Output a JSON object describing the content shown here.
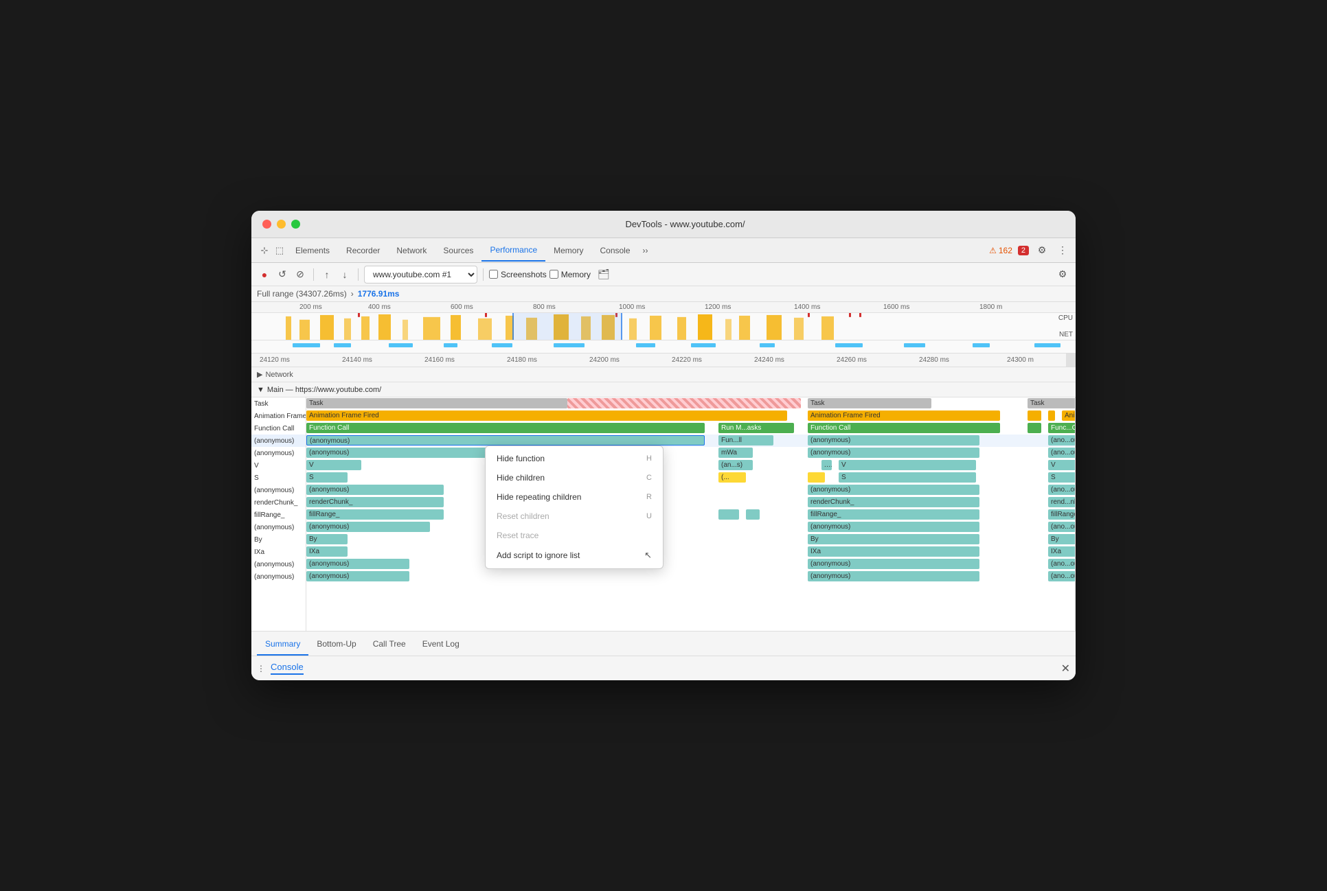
{
  "window": {
    "title": "DevTools - www.youtube.com/"
  },
  "tabs": [
    {
      "label": "Elements",
      "active": false
    },
    {
      "label": "Recorder",
      "active": false
    },
    {
      "label": "Network",
      "active": false
    },
    {
      "label": "Sources",
      "active": false
    },
    {
      "label": "Performance",
      "active": true
    },
    {
      "label": "Memory",
      "active": false
    },
    {
      "label": "Console",
      "active": false
    }
  ],
  "badges": {
    "warning": "162",
    "error": "2"
  },
  "toolbar": {
    "record_label": "●",
    "reload_label": "↺",
    "clear_label": "⊘",
    "upload_label": "↑",
    "download_label": "↓",
    "url_value": "www.youtube.com #1",
    "screenshots_label": "Screenshots",
    "memory_label": "Memory"
  },
  "range": {
    "full_label": "Full range (34307.26ms)",
    "selected_label": "1776.91ms"
  },
  "ruler": {
    "marks": [
      "24120 ms",
      "24140 ms",
      "24160 ms",
      "24180 ms",
      "24200 ms",
      "24220 ms",
      "24240 ms",
      "24260 ms",
      "24280 ms",
      "24300 m"
    ]
  },
  "overview": {
    "ms_marks": [
      "200 ms",
      "400 ms",
      "600 ms",
      "800 ms",
      "1000 ms",
      "1200 ms",
      "1400 ms",
      "1600 ms",
      "1800 m"
    ],
    "cpu_label": "CPU",
    "net_label": "NET"
  },
  "network_section": {
    "label": "Network",
    "collapsed": false
  },
  "main_thread": {
    "label": "Main — https://www.youtube.com/"
  },
  "flame_rows": [
    {
      "label": "Task",
      "type": "task"
    },
    {
      "label": "Animation Frame Fired",
      "type": "animation"
    },
    {
      "label": "Function Call",
      "type": "func"
    },
    {
      "label": "(anonymous)",
      "type": "anon"
    },
    {
      "label": "(anonymous)",
      "type": "anon"
    },
    {
      "label": "V",
      "type": "v"
    },
    {
      "label": "S",
      "type": "s"
    },
    {
      "label": "(anonymous)",
      "type": "anon"
    },
    {
      "label": "renderChunk_",
      "type": "anon"
    },
    {
      "label": "fillRange_",
      "type": "anon"
    },
    {
      "label": "(anonymous)",
      "type": "anon"
    },
    {
      "label": "By",
      "type": "anon"
    },
    {
      "label": "IXa",
      "type": "anon"
    },
    {
      "label": "(anonymous)",
      "type": "anon"
    },
    {
      "label": "(anonymous)",
      "type": "anon"
    }
  ],
  "context_menu": {
    "items": [
      {
        "label": "Hide function",
        "shortcut": "H",
        "disabled": false
      },
      {
        "label": "Hide children",
        "shortcut": "C",
        "disabled": false
      },
      {
        "label": "Hide repeating children",
        "shortcut": "R",
        "disabled": false
      },
      {
        "label": "Reset children",
        "shortcut": "U",
        "disabled": true
      },
      {
        "label": "Reset trace",
        "shortcut": "",
        "disabled": true
      },
      {
        "label": "Add script to ignore list",
        "shortcut": "",
        "disabled": false
      }
    ]
  },
  "bottom_tabs": [
    {
      "label": "Summary",
      "active": true
    },
    {
      "label": "Bottom-Up",
      "active": false
    },
    {
      "label": "Call Tree",
      "active": false
    },
    {
      "label": "Event Log",
      "active": false
    }
  ],
  "console_bar": {
    "dots": "⋮",
    "label": "Console",
    "close": "✕"
  }
}
